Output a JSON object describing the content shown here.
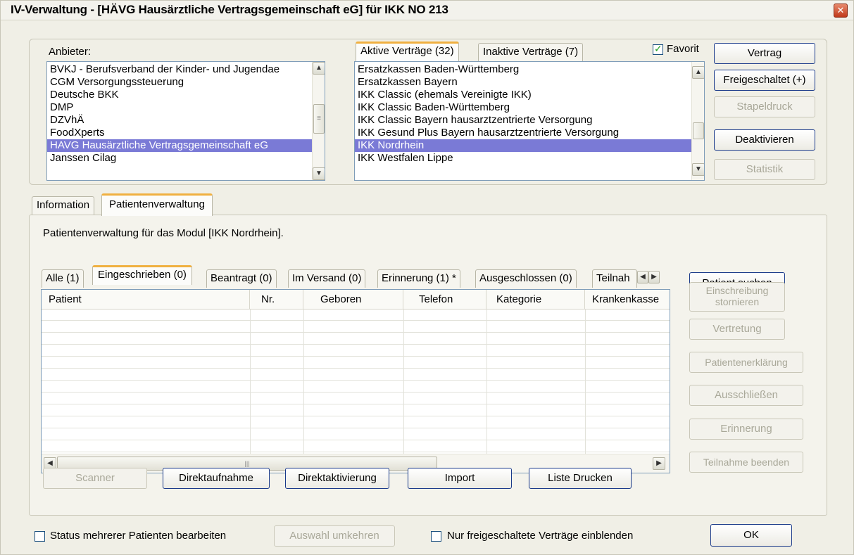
{
  "window": {
    "title": "IV-Verwaltung - [HÄVG Hausärztliche Vertragsgemeinschaft eG] für IKK NO 213",
    "close_icon": "close-icon"
  },
  "provider": {
    "label": "Anbieter:",
    "items": [
      "BVKJ - Berufsverband der Kinder- und Jugendae",
      "CGM Versorgungssteuerung",
      "Deutsche BKK",
      "DMP",
      "DZVhÄ",
      "FoodXperts",
      "HAVG Hausärztliche Vertragsgemeinschaft eG",
      "Janssen Cilag"
    ],
    "selected_index": 6
  },
  "contract_tabs": {
    "active": "Aktive Verträge (32)",
    "inactive": "Inaktive Verträge (7)"
  },
  "favorit": {
    "label": "Favorit",
    "checked": true
  },
  "contracts": {
    "items": [
      "Ersatzkassen Baden-Württemberg",
      "Ersatzkassen Bayern",
      "IKK Classic (ehemals Vereinigte IKK)",
      "IKK Classic Baden-Württemberg",
      "IKK Classic Bayern hausarztzentrierte Versorgung",
      "IKK Gesund Plus Bayern hausarztzentrierte Versorgung",
      "IKK Nordrhein",
      "IKK Westfalen Lippe"
    ],
    "selected_index": 6
  },
  "right_buttons": {
    "vertrag": "Vertrag",
    "freigeschaltet": "Freigeschaltet (+)",
    "stapeldruck": "Stapeldruck",
    "deaktivieren": "Deaktivieren",
    "statistik": "Statistik"
  },
  "main_tabs": {
    "information": "Information",
    "patientenverwaltung": "Patientenverwaltung"
  },
  "panel": {
    "heading": "Patientenverwaltung für das Modul [IKK Nordrhein]."
  },
  "status_tabs": [
    "Alle (1)",
    "Eingeschrieben (0)",
    "Beantragt (0)",
    "Im Versand (0)",
    "Erinnerung (1) *",
    "Ausgeschlossen (0)",
    "Teilnah"
  ],
  "status_tab_active": 1,
  "table": {
    "columns": [
      "Patient",
      "Nr.",
      "Geboren",
      "Telefon",
      "Kategorie",
      "Krankenkasse"
    ],
    "rows": []
  },
  "side_buttons": {
    "patient_suchen": "Patient suchen",
    "einschreibung_1": "Einschreibung",
    "einschreibung_2": "stornieren",
    "vertretung": "Vertretung",
    "patientenerklaerung": "Patientenerklärung",
    "ausschliessen": "Ausschließen",
    "erinnerung": "Erinnerung",
    "teilnahme_beenden": "Teilnahme beenden"
  },
  "bottom_buttons": {
    "scanner": "Scanner",
    "direktaufnahme": "Direktaufnahme",
    "direktaktivierung": "Direktaktivierung",
    "import": "Import",
    "liste_drucken": "Liste Drucken"
  },
  "footer": {
    "status_mehrerer": "Status mehrerer Patienten bearbeiten",
    "auswahl_umkehren": "Auswahl umkehren",
    "nur_freigeschaltete": "Nur freigeschaltete Verträge einblenden",
    "ok": "OK"
  },
  "icons": {
    "scroll_up": "▲",
    "scroll_down": "▼",
    "scroll_left": "◀",
    "scroll_right": "▶",
    "grip": "≡",
    "hgrip": "|||"
  }
}
